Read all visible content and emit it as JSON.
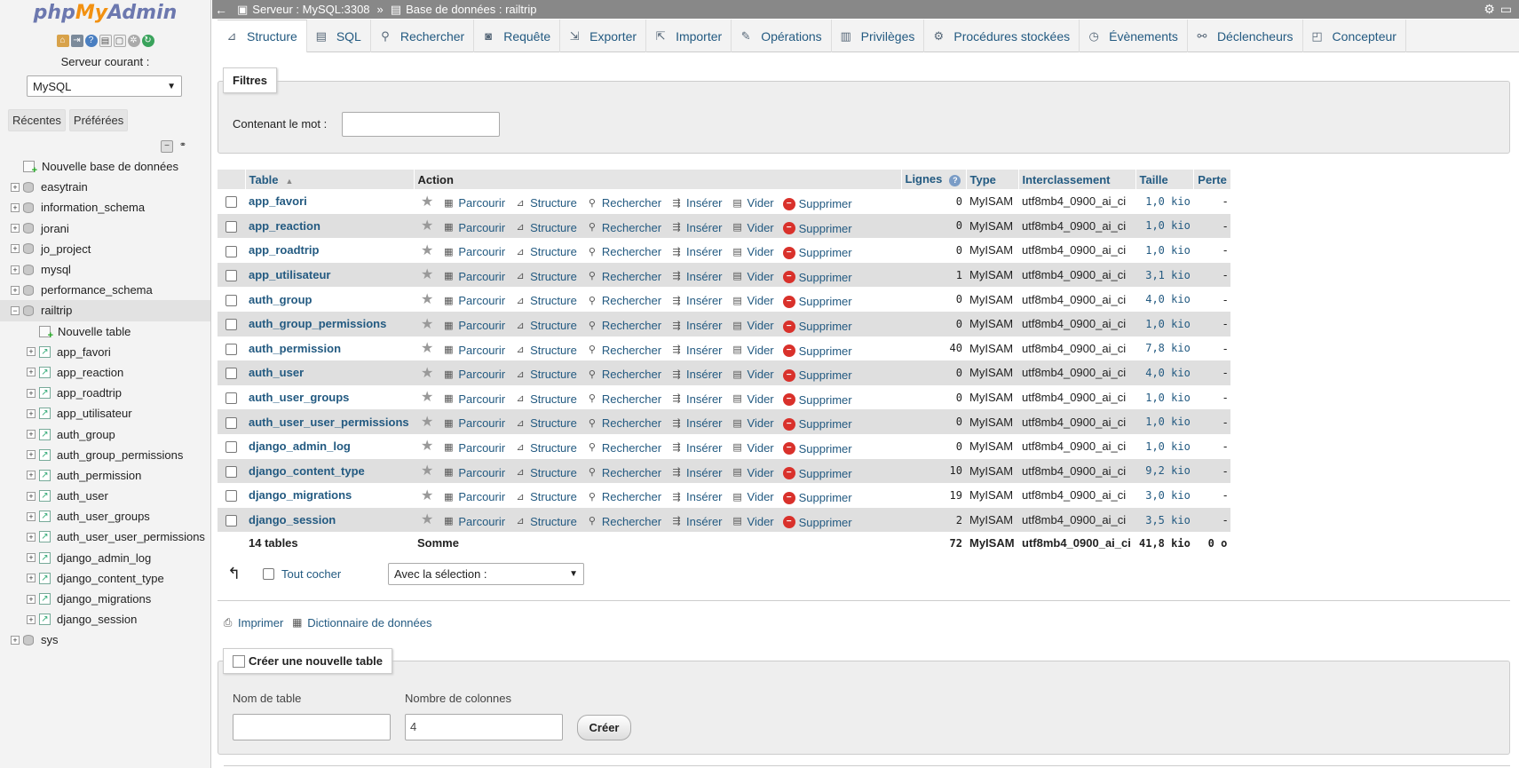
{
  "app": {
    "logo_php": "php",
    "logo_my": "My",
    "logo_admin": "Admin"
  },
  "nav": {
    "server_label": "Serveur courant :",
    "server_select": "MySQL",
    "recent_label": "Récentes",
    "favorites_label": "Préférées",
    "new_database": "Nouvelle base de données",
    "databases_before": [
      "easytrain",
      "information_schema",
      "jorani",
      "jo_project",
      "mysql",
      "performance_schema"
    ],
    "current_db": "railtrip",
    "new_table": "Nouvelle table",
    "tables": [
      "app_favori",
      "app_reaction",
      "app_roadtrip",
      "app_utilisateur",
      "auth_group",
      "auth_group_permissions",
      "auth_permission",
      "auth_user",
      "auth_user_groups",
      "auth_user_user_permissions",
      "django_admin_log",
      "django_content_type",
      "django_migrations",
      "django_session"
    ],
    "databases_after": [
      "sys"
    ]
  },
  "breadcrumb": {
    "server": "Serveur : MySQL:3308",
    "separator": "»",
    "database": "Base de données : railtrip"
  },
  "tabs": [
    {
      "label": "Structure",
      "icon": "structure-icon"
    },
    {
      "label": "SQL",
      "icon": "sql-icon"
    },
    {
      "label": "Rechercher",
      "icon": "search-icon"
    },
    {
      "label": "Requête",
      "icon": "query-icon"
    },
    {
      "label": "Exporter",
      "icon": "export-icon"
    },
    {
      "label": "Importer",
      "icon": "import-icon"
    },
    {
      "label": "Opérations",
      "icon": "operations-icon"
    },
    {
      "label": "Privilèges",
      "icon": "privileges-icon"
    },
    {
      "label": "Procédures stockées",
      "icon": "routines-icon"
    },
    {
      "label": "Évènements",
      "icon": "events-icon"
    },
    {
      "label": "Déclencheurs",
      "icon": "triggers-icon"
    },
    {
      "label": "Concepteur",
      "icon": "designer-icon"
    }
  ],
  "filter": {
    "legend": "Filtres",
    "label": "Contenant le mot :",
    "value": ""
  },
  "table": {
    "headers": {
      "table": "Table",
      "action": "Action",
      "rows": "Lignes",
      "type": "Type",
      "collation": "Interclassement",
      "size": "Taille",
      "overhead": "Perte"
    },
    "actions": {
      "browse": "Parcourir",
      "structure": "Structure",
      "search": "Rechercher",
      "insert": "Insérer",
      "empty": "Vider",
      "drop": "Supprimer"
    },
    "rows": [
      {
        "name": "app_favori",
        "rows": "0",
        "type": "MyISAM",
        "collation": "utf8mb4_0900_ai_ci",
        "size": "1,0 kio",
        "overhead": "-"
      },
      {
        "name": "app_reaction",
        "rows": "0",
        "type": "MyISAM",
        "collation": "utf8mb4_0900_ai_ci",
        "size": "1,0 kio",
        "overhead": "-"
      },
      {
        "name": "app_roadtrip",
        "rows": "0",
        "type": "MyISAM",
        "collation": "utf8mb4_0900_ai_ci",
        "size": "1,0 kio",
        "overhead": "-"
      },
      {
        "name": "app_utilisateur",
        "rows": "1",
        "type": "MyISAM",
        "collation": "utf8mb4_0900_ai_ci",
        "size": "3,1 kio",
        "overhead": "-"
      },
      {
        "name": "auth_group",
        "rows": "0",
        "type": "MyISAM",
        "collation": "utf8mb4_0900_ai_ci",
        "size": "4,0 kio",
        "overhead": "-"
      },
      {
        "name": "auth_group_permissions",
        "rows": "0",
        "type": "MyISAM",
        "collation": "utf8mb4_0900_ai_ci",
        "size": "1,0 kio",
        "overhead": "-"
      },
      {
        "name": "auth_permission",
        "rows": "40",
        "type": "MyISAM",
        "collation": "utf8mb4_0900_ai_ci",
        "size": "7,8 kio",
        "overhead": "-"
      },
      {
        "name": "auth_user",
        "rows": "0",
        "type": "MyISAM",
        "collation": "utf8mb4_0900_ai_ci",
        "size": "4,0 kio",
        "overhead": "-"
      },
      {
        "name": "auth_user_groups",
        "rows": "0",
        "type": "MyISAM",
        "collation": "utf8mb4_0900_ai_ci",
        "size": "1,0 kio",
        "overhead": "-"
      },
      {
        "name": "auth_user_user_permissions",
        "rows": "0",
        "type": "MyISAM",
        "collation": "utf8mb4_0900_ai_ci",
        "size": "1,0 kio",
        "overhead": "-"
      },
      {
        "name": "django_admin_log",
        "rows": "0",
        "type": "MyISAM",
        "collation": "utf8mb4_0900_ai_ci",
        "size": "1,0 kio",
        "overhead": "-"
      },
      {
        "name": "django_content_type",
        "rows": "10",
        "type": "MyISAM",
        "collation": "utf8mb4_0900_ai_ci",
        "size": "9,2 kio",
        "overhead": "-"
      },
      {
        "name": "django_migrations",
        "rows": "19",
        "type": "MyISAM",
        "collation": "utf8mb4_0900_ai_ci",
        "size": "3,0 kio",
        "overhead": "-"
      },
      {
        "name": "django_session",
        "rows": "2",
        "type": "MyISAM",
        "collation": "utf8mb4_0900_ai_ci",
        "size": "3,5 kio",
        "overhead": "-"
      }
    ],
    "summary": {
      "count": "14 tables",
      "label": "Somme",
      "rows": "72",
      "type": "MyISAM",
      "collation": "utf8mb4_0900_ai_ci",
      "size": "41,8 kio",
      "overhead": "0 o"
    }
  },
  "bulk": {
    "check_all": "Tout cocher",
    "with_selected": "Avec la sélection :"
  },
  "links": {
    "print": "Imprimer",
    "data_dictionary": "Dictionnaire de données"
  },
  "create": {
    "legend": "Créer une nouvelle table",
    "name_label": "Nom de table",
    "name_value": "",
    "cols_label": "Nombre de colonnes",
    "cols_value": "4",
    "button": "Créer"
  }
}
